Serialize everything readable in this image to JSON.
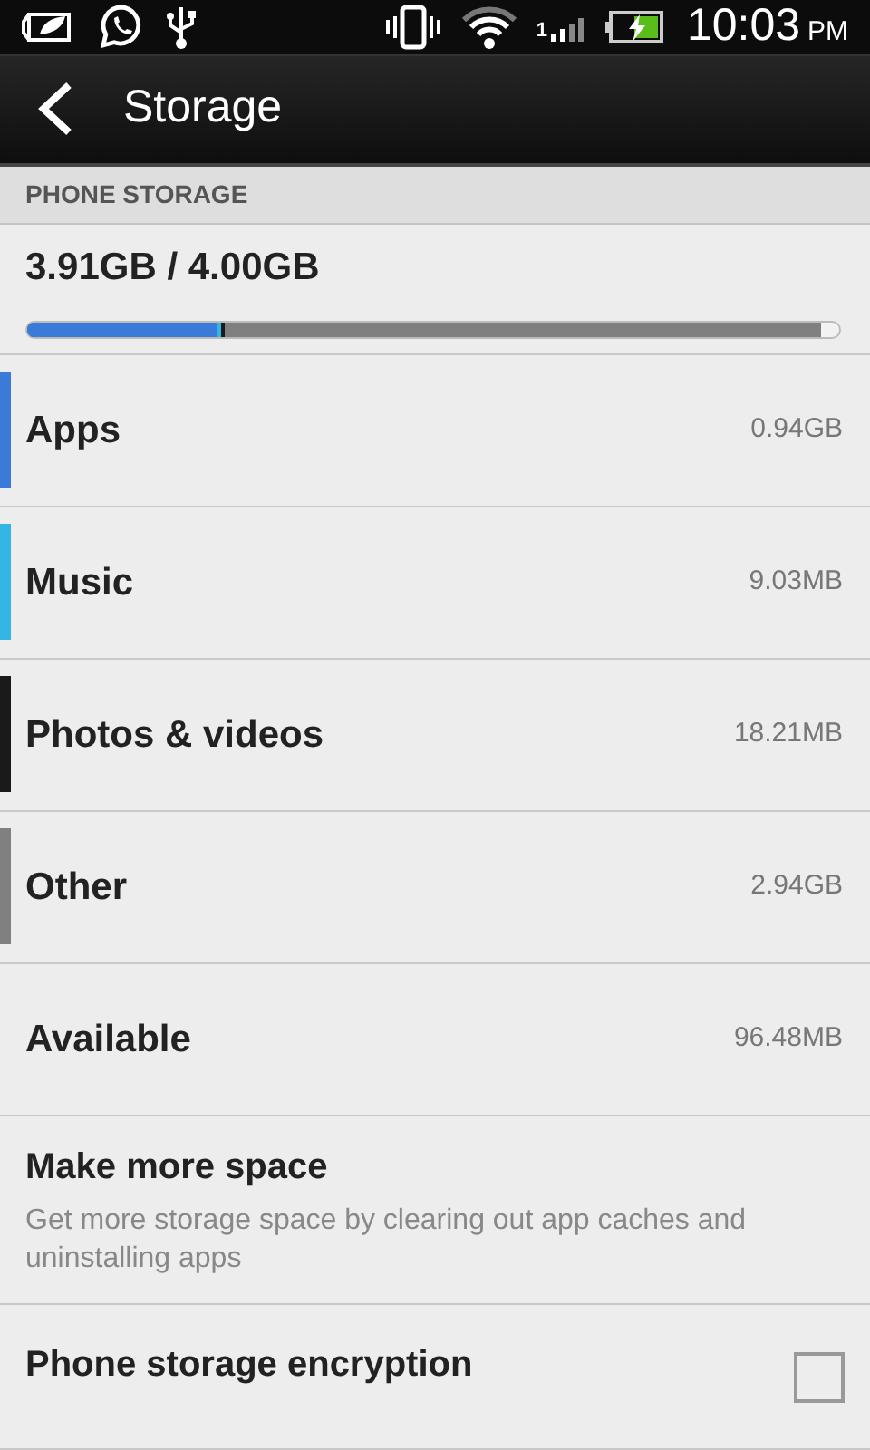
{
  "status_bar": {
    "signal_label": "1",
    "time": "10:03",
    "ampm": "PM"
  },
  "app_bar": {
    "title": "Storage"
  },
  "section": {
    "header": "PHONE STORAGE",
    "usage": "3.91GB / 4.00GB"
  },
  "categories": [
    {
      "name": "Apps",
      "size": "0.94GB",
      "color": "#3a7ad8",
      "level": 0.235
    },
    {
      "name": "Music",
      "size": "9.03MB",
      "color": "#33b5e5",
      "level": 0.238
    },
    {
      "name": "Photos & videos",
      "size": "18.21MB",
      "color": "#1a1a1a",
      "level": 0.243
    },
    {
      "name": "Other",
      "size": "2.94GB",
      "color": "#808080",
      "level": 0.977
    }
  ],
  "available": {
    "name": "Available",
    "size": "96.48MB"
  },
  "actions": [
    {
      "kind": "link",
      "title": "Make more space",
      "summary": "Get more storage space by clearing out app caches and uninstalling apps"
    },
    {
      "kind": "checkbox",
      "title": "Phone storage encryption",
      "checked": false
    }
  ]
}
